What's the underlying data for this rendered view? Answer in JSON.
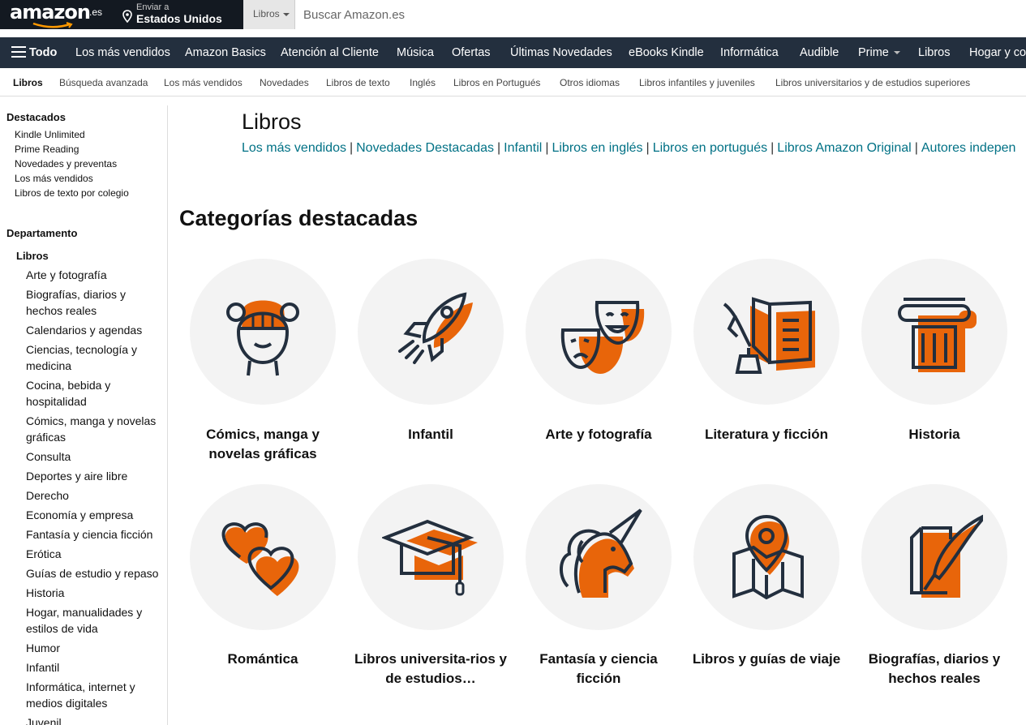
{
  "header": {
    "logo_text": "amazon",
    "logo_tld": ".es",
    "deliver_line1": "Enviar a",
    "deliver_line2": "Estados Unidos",
    "search_category": "Libros",
    "search_placeholder": "Buscar Amazon.es"
  },
  "main_nav": {
    "all_label": "Todo",
    "items": [
      "Los más vendidos",
      "Amazon Basics",
      "Atención al Cliente",
      "Música",
      "Ofertas",
      "Últimas Novedades",
      "eBooks Kindle",
      "Informática",
      "Audible",
      "Prime",
      "Libros",
      "Hogar y co"
    ]
  },
  "sub_nav": {
    "items": [
      "Libros",
      "Búsqueda avanzada",
      "Los más vendidos",
      "Novedades",
      "Libros de texto",
      "Inglés",
      "Libros en Portugués",
      "Otros idiomas",
      "Libros infantiles y juveniles",
      "Libros universitarios y de estudios superiores"
    ]
  },
  "sidebar": {
    "featured_title": "Destacados",
    "featured_links": [
      "Kindle Unlimited",
      "Prime Reading",
      "Novedades y preventas",
      "Los más vendidos",
      "Libros de texto por colegio"
    ],
    "department_title": "Departamento",
    "department_root": "Libros",
    "categories": [
      "Arte y fotografía",
      "Biografías, diarios y hechos reales",
      "Calendarios y agendas",
      "Ciencias, tecnología y medicina",
      "Cocina, bebida y hospitalidad",
      "Cómics, manga y novelas gráficas",
      "Consulta",
      "Deportes y aire libre",
      "Derecho",
      "Economía y empresa",
      "Fantasía y ciencia ficción",
      "Erótica",
      "Guías de estudio y repaso",
      "Historia",
      "Hogar, manualidades y estilos de vida",
      "Humor",
      "Infantil",
      "Informática, internet y medios digitales",
      "Juvenil"
    ]
  },
  "main": {
    "title": "Libros",
    "links": [
      "Los más vendidos",
      "Novedades Destacadas",
      "Infantil",
      "Libros en inglés",
      "Libros en portugués",
      "Libros Amazon Original",
      "Autores indepen"
    ],
    "link_separator": "|",
    "section_title": "Categorías destacadas",
    "categories": [
      {
        "label": "Cómics, manga y novelas gráficas",
        "icon": "comic-girl-icon"
      },
      {
        "label": "Infantil",
        "icon": "rocket-icon"
      },
      {
        "label": "Arte y fotografía",
        "icon": "theater-masks-icon"
      },
      {
        "label": "Literatura y ficción",
        "icon": "book-quill-icon"
      },
      {
        "label": "Historia",
        "icon": "column-icon"
      },
      {
        "label": "Romántica",
        "icon": "hearts-icon"
      },
      {
        "label": "Libros universita-rios y de estudios…",
        "icon": "graduation-cap-icon"
      },
      {
        "label": "Fantasía y ciencia ficción",
        "icon": "unicorn-icon"
      },
      {
        "label": "Libros y guías de viaje",
        "icon": "map-pin-icon"
      },
      {
        "label": "Biografías, diarios y hechos reales",
        "icon": "document-quill-icon"
      }
    ]
  },
  "colors": {
    "nav_dark": "#131921",
    "nav_main": "#232f3e",
    "link": "#007185",
    "icon_orange": "#e8650a",
    "icon_stroke": "#232f3e",
    "tile_bg": "#f3f3f3"
  }
}
